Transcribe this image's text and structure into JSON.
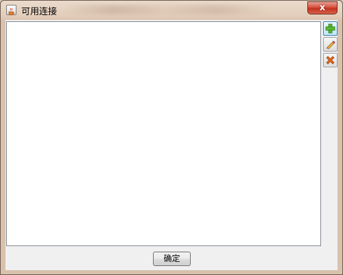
{
  "window": {
    "title": "可用连接",
    "close_glyph": "x"
  },
  "icons": {
    "app": "java-cup-icon",
    "add": "add-icon",
    "edit": "pencil-icon",
    "delete": "delete-icon"
  },
  "colors": {
    "add_icon": "#5cb82e",
    "delete_icon": "#e06a1c",
    "close_button": "#c83a26"
  },
  "footer": {
    "ok_label": "确定"
  }
}
